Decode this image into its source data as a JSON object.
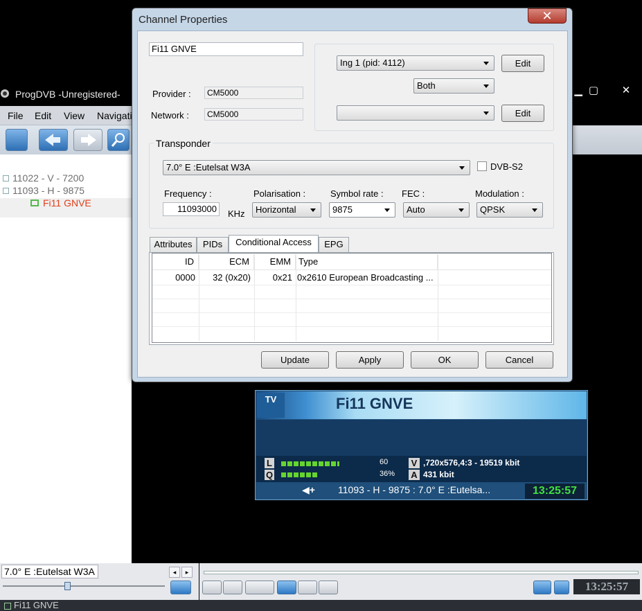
{
  "main_window": {
    "title": "ProgDVB -Unregistered-",
    "menu": [
      "File",
      "Edit",
      "View",
      "Navigatio"
    ],
    "window_buttons": [
      "minimize",
      "maximize",
      "close"
    ]
  },
  "channel_tree": {
    "items": [
      {
        "label": "11022 - V - 7200",
        "expanded": false
      },
      {
        "label": "11093 - H - 9875",
        "expanded": true
      },
      {
        "label": "Fi11 GNVE",
        "selected": true
      }
    ]
  },
  "satellite_label": "7.0° E :Eutelsat W3A",
  "osd": {
    "tv_badge": "TV",
    "channel": "Fi11 GNVE",
    "l_label": "L",
    "q_label": "Q",
    "level_value": "60",
    "quality_value": "36%",
    "v_label": "V",
    "a_label": "A",
    "video_info": ",720x576,4:3 - 19519 kbit",
    "audio_info": "431 kbit",
    "transponder": "11093 - H - 9875 : 7.0° E :Eutelsa...",
    "time": "13:25:57"
  },
  "player": {
    "clock": "13:25:57"
  },
  "status_bar": {
    "channel": "Fi11 GNVE"
  },
  "dialog": {
    "title": "Channel Properties",
    "close_label": "✕",
    "channel_name": "Fi11 GNVE",
    "provider_label": "Provider :",
    "provider_value": "CM5000",
    "network_label": "Network :",
    "network_value": "CM5000",
    "audio_track": "Ing 1 (pid: 4112)",
    "audio_channel": "Both",
    "subtitle_track": "",
    "edit_label": "Edit",
    "transponder_group": "Transponder",
    "transponder_value": "7.0° E :Eutelsat W3A",
    "dvbs2_label": "DVB-S2",
    "dvbs2_checked": false,
    "frequency_label": "Frequency :",
    "frequency_value": "11093000",
    "frequency_unit": "KHz",
    "polarisation_label": "Polarisation :",
    "polarisation_value": "Horizontal",
    "symbol_rate_label": "Symbol rate :",
    "symbol_rate_value": "9875",
    "fec_label": "FEC :",
    "fec_value": "Auto",
    "modulation_label": "Modulation :",
    "modulation_value": "QPSK",
    "tabs": [
      "Attributes",
      "PIDs",
      "Conditional Access",
      "EPG"
    ],
    "active_tab": "Conditional Access",
    "ca_table": {
      "columns": [
        "ID",
        "ECM",
        "EMM",
        "Type"
      ],
      "rows": [
        {
          "id": "0000",
          "ecm": "32 (0x20)",
          "emm": "0x21",
          "type": "0x2610 European Broadcasting ..."
        }
      ]
    },
    "buttons": {
      "update": "Update",
      "apply": "Apply",
      "ok": "OK",
      "cancel": "Cancel"
    }
  }
}
